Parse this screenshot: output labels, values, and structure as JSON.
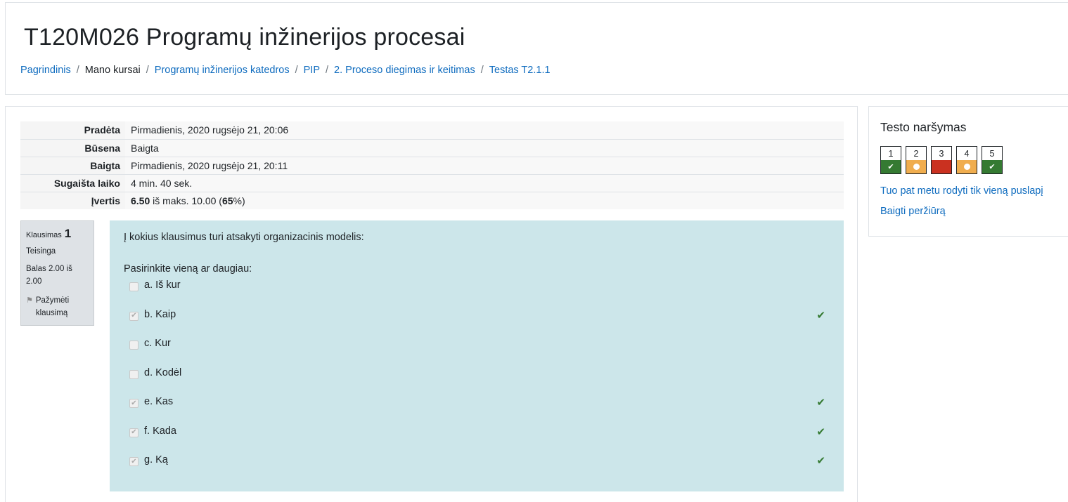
{
  "header": {
    "title": "T120M026 Programų inžinerijos procesai",
    "breadcrumb": [
      {
        "label": "Pagrindinis",
        "link": true
      },
      {
        "label": "Mano kursai",
        "link": false
      },
      {
        "label": "Programų inžinerijos katedros",
        "link": true
      },
      {
        "label": "PIP",
        "link": true
      },
      {
        "label": "2. Proceso diegimas ir keitimas",
        "link": true
      },
      {
        "label": "Testas T2.1.1",
        "link": true
      }
    ]
  },
  "summary": {
    "rows": [
      {
        "label": "Pradėta",
        "value": "Pirmadienis, 2020 rugsėjo 21, 20:06"
      },
      {
        "label": "Būsena",
        "value": "Baigta"
      },
      {
        "label": "Baigta",
        "value": "Pirmadienis, 2020 rugsėjo 21, 20:11"
      },
      {
        "label": "Sugaišta laiko",
        "value": "4 min. 40 sek."
      }
    ],
    "grade_label": "Įvertis",
    "grade_score": "6.50",
    "grade_mid": " iš maks. 10.00 (",
    "grade_percent": "65",
    "grade_end": "%)"
  },
  "question": {
    "label": "Klausimas",
    "number": "1",
    "state": "Teisinga",
    "grade": "Balas 2.00 iš 2.00",
    "flag_label": "Pažymėti klausimą",
    "text": "Į kokius klausimus turi atsakyti organizacinis modelis:",
    "prompt": "Pasirinkite vieną ar daugiau:",
    "answers": [
      {
        "label": "a. Iš kur",
        "checked": false,
        "correct": false
      },
      {
        "label": "b. Kaip",
        "checked": true,
        "correct": true
      },
      {
        "label": "c. Kur",
        "checked": false,
        "correct": false
      },
      {
        "label": "d. Kodėl",
        "checked": false,
        "correct": false
      },
      {
        "label": "e. Kas",
        "checked": true,
        "correct": true
      },
      {
        "label": "f. Kada",
        "checked": true,
        "correct": true
      },
      {
        "label": "g. Ką",
        "checked": true,
        "correct": true
      }
    ]
  },
  "nav": {
    "title": "Testo naršymas",
    "buttons": [
      {
        "number": "1",
        "state": "correct"
      },
      {
        "number": "2",
        "state": "partial"
      },
      {
        "number": "3",
        "state": "wrong"
      },
      {
        "number": "4",
        "state": "partial"
      },
      {
        "number": "5",
        "state": "correct"
      }
    ],
    "single_page_link": "Tuo pat metu rodyti tik vieną puslapį",
    "finish_link": "Baigti peržiūrą"
  },
  "colors": {
    "link": "#0f6cbf",
    "correct": "#357a32",
    "partial": "#f0ad4e",
    "wrong": "#ca3120",
    "question_bg": "#cce6ea"
  }
}
